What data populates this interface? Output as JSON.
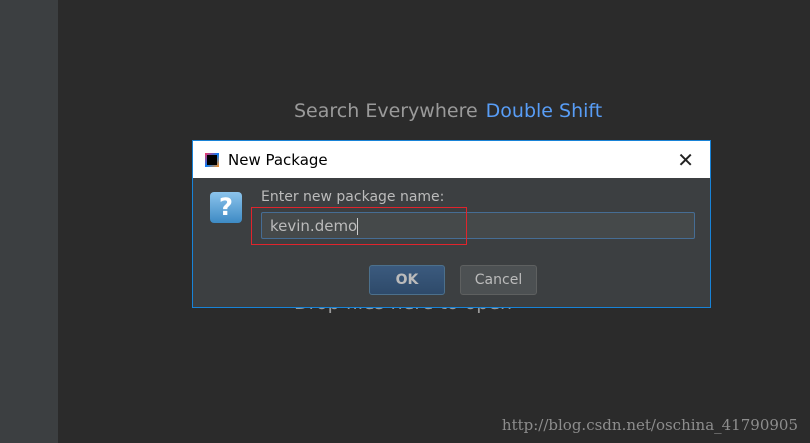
{
  "welcome": {
    "search_label": "Search Everywhere",
    "search_shortcut": "Double Shift",
    "drop_label": "Drop files here to open"
  },
  "dialog": {
    "title": "New Package",
    "prompt": "Enter new package name:",
    "value": "kevin.demo",
    "ok_label": "OK",
    "cancel_label": "Cancel",
    "close_glyph": "✕",
    "question_glyph": "?"
  },
  "watermark": "http://blog.csdn.net/oschina_41790905"
}
